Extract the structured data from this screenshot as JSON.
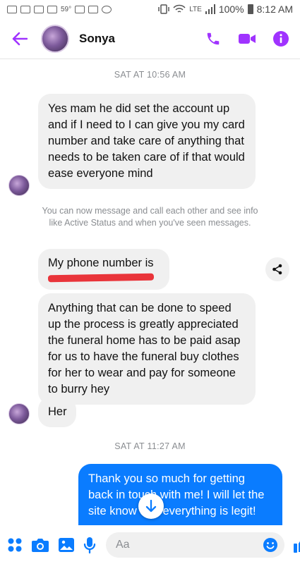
{
  "status_bar": {
    "temperature": "59°",
    "lte": "LTE",
    "battery": "100%",
    "time": "8:12 AM"
  },
  "header": {
    "contact_name": "Sonya",
    "accent_color": "#a033ff"
  },
  "conversation": {
    "timestamp_1": "SAT AT 10:56 AM",
    "message_1": "Yes mam he did set the account up and if I need to I can give you my card number and take care of anything that needs to be taken care of if that would ease everyone mind",
    "system_notice": "You can now message and call each other and see info like Active Status and when you've seen messages.",
    "message_2": "My phone number is",
    "message_3": "Anything that can be done to speed up the process is greatly appreciated the funeral home has to be paid asap for us to have the funeral buy clothes for her to wear and pay for someone to burry hey",
    "message_4": "Her",
    "timestamp_2": "SAT AT 11:27 AM",
    "message_5": "Thank you so much for getting back in touch with me!  I will let the site know that everything is legit!"
  },
  "composer": {
    "placeholder": "Aa",
    "icon_color": "#0a7cff"
  }
}
